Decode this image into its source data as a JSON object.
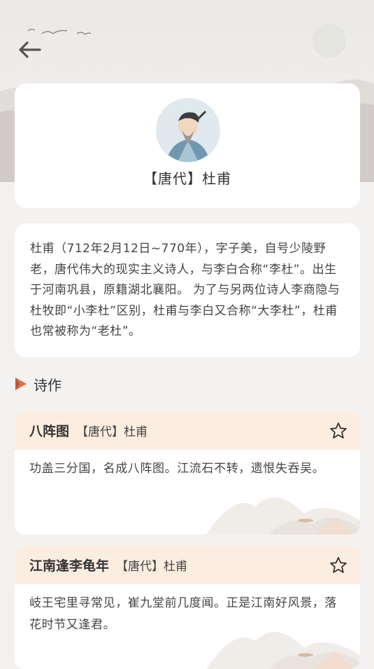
{
  "nav": {
    "back_icon": "arrow-left-icon"
  },
  "poet": {
    "name": "【唐代】杜甫",
    "avatar_icon": "poet-portrait",
    "bio": "杜甫（712年2月12日~770年），字子美，自号少陵野老，唐代伟大的现实主义诗人，与李白合称“李杜”。出生于河南巩县，原籍湖北襄阳。 为了与另两位诗人李商隐与杜牧即“小李杜”区别，杜甫与李白又合称“大李杜”，杜甫也常被称为“老杜”。"
  },
  "section": {
    "title": "诗作",
    "marker_icon": "triangle-marker-icon"
  },
  "poems": [
    {
      "title": "八阵图",
      "meta": "【唐代】杜甫",
      "content": "功盖三分国，名成八阵图。江流石不转，遗恨失吞吴。",
      "favorite_icon": "star-outline-icon"
    },
    {
      "title": "江南逢李龟年",
      "meta": "【唐代】杜甫",
      "content": "岐王宅里寻常见，崔九堂前几度闻。正是江南好风景，落花时节又逢君。",
      "favorite_icon": "star-outline-icon"
    }
  ],
  "colors": {
    "background": "#f4f2f1",
    "card": "#ffffff",
    "poem_header": "#fbeee0",
    "accent": "#c96b4a"
  }
}
